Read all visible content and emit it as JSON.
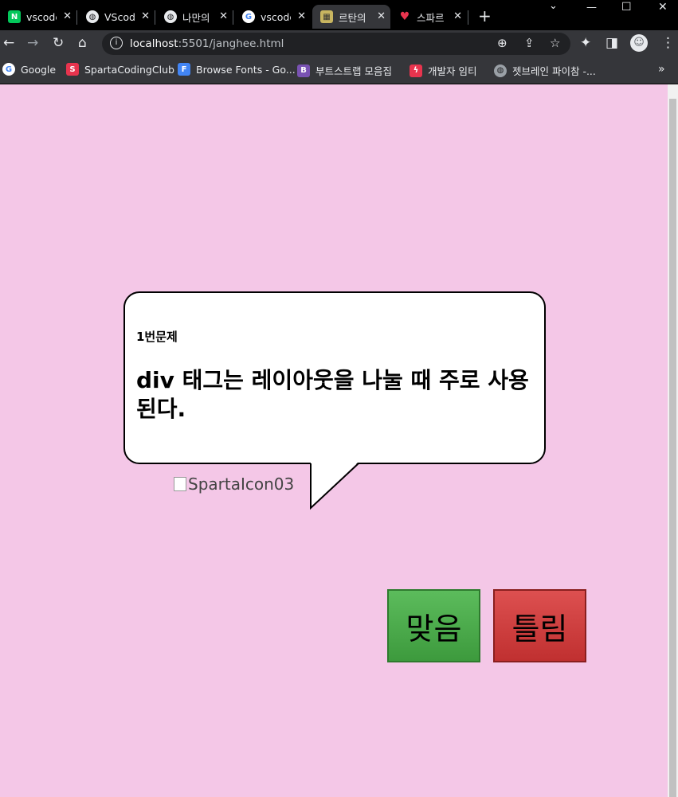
{
  "browser": {
    "tabs": [
      {
        "title": "vscode",
        "icon": "naver-icon",
        "color": "#03c75a",
        "glyph": "N"
      },
      {
        "title": "VScode",
        "icon": "globe-icon",
        "color": "#e8eaed",
        "glyph": "◍"
      },
      {
        "title": "나만의",
        "icon": "globe-icon",
        "color": "#e8eaed",
        "glyph": "◍"
      },
      {
        "title": "vscode",
        "icon": "google-icon",
        "color": "#ffffff",
        "glyph": "G"
      },
      {
        "title": "르탄의",
        "icon": "pixel-icon",
        "color": "#c8b560",
        "glyph": "▦"
      },
      {
        "title": "스파르",
        "icon": "sparta-heart-icon",
        "color": "#e8344e",
        "glyph": "♥"
      }
    ],
    "address": {
      "host": "localhost",
      "path": ":5501/janghee.html"
    },
    "bookmarks": [
      {
        "label": "Google",
        "icon": "google-icon",
        "color": "#ffffff",
        "glyph": "G"
      },
      {
        "label": "SpartaCodingClub",
        "icon": "sparta-icon",
        "color": "#e8344e",
        "glyph": "S"
      },
      {
        "label": "Browse Fonts - Go...",
        "icon": "google-fonts-icon",
        "color": "#4285f4",
        "glyph": "F"
      },
      {
        "label": "부트스트랩 모음집",
        "icon": "bootstrap-icon",
        "color": "#7952b3",
        "glyph": "B"
      },
      {
        "label": "개발자 임티",
        "icon": "bolt-icon",
        "color": "#e8344e",
        "glyph": "ϟ"
      },
      {
        "label": "젯브레인 파이참 -...",
        "icon": "globe-icon",
        "color": "#9aa0a6",
        "glyph": "◍"
      }
    ]
  },
  "quiz": {
    "number_label": "1번문제",
    "question": "div 태그는 레이아웃을 나눌 때 주로 사용된다.",
    "image_alt": "SpartaIcon03",
    "answer_yes": "맞음",
    "answer_no": "틀림"
  },
  "colors": {
    "page_bg": "#f4c7e7",
    "yes_button": "#4caf50",
    "no_button": "#d84343"
  }
}
